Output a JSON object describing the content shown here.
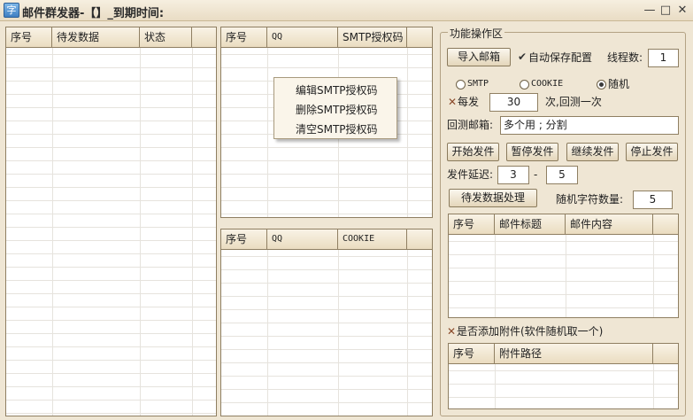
{
  "window": {
    "icon": "mail-app-icon",
    "icon_glyph": "字",
    "title": "邮件群发器-【】_到期时间:",
    "controls": {
      "minimize": "—",
      "maximize": "□",
      "close": "✕"
    }
  },
  "left_table": {
    "columns": [
      "序号",
      "待发数据",
      "状态"
    ]
  },
  "smtp_table": {
    "columns": [
      "序号",
      "QQ",
      "SMTP授权码"
    ]
  },
  "context_menu": {
    "items": [
      "编辑SMTP授权码",
      "删除SMTP授权码",
      "清空SMTP授权码"
    ]
  },
  "cookie_table": {
    "columns": [
      "序号",
      "QQ",
      "COOKIE"
    ]
  },
  "ops": {
    "title": "功能操作区",
    "import_mailbox": "导入邮箱",
    "auto_save_check": "✔",
    "auto_save": "自动保存配置",
    "threads_label": "线程数:",
    "threads_value": "1",
    "mode_smtp": "SMTP",
    "mode_cookie": "COOKIE",
    "mode_random": "随机",
    "mode_selected": "随机",
    "every_check": "✕",
    "every_label": "每发",
    "every_value": "30",
    "every_suffix": "次,回测一次",
    "recheck_label": "回测邮箱:",
    "recheck_value": "多个用 ; 分割",
    "start_send": "开始发件",
    "pause_send": "暂停发件",
    "continue_send": "继续发件",
    "stop_send": "停止发件",
    "delay_label": "发件延迟:",
    "delay_min": "3",
    "delay_dash": "-",
    "delay_max": "5",
    "process_data": "待发数据处理",
    "random_chars_label": "随机字符数量:",
    "random_chars_value": "5",
    "attach_check": "✕",
    "attach_label": "是否添加附件(软件随机取一个)"
  },
  "mail_table": {
    "columns": [
      "序号",
      "邮件标题",
      "邮件内容"
    ]
  },
  "attach_table": {
    "columns": [
      "序号",
      "附件路径"
    ]
  }
}
